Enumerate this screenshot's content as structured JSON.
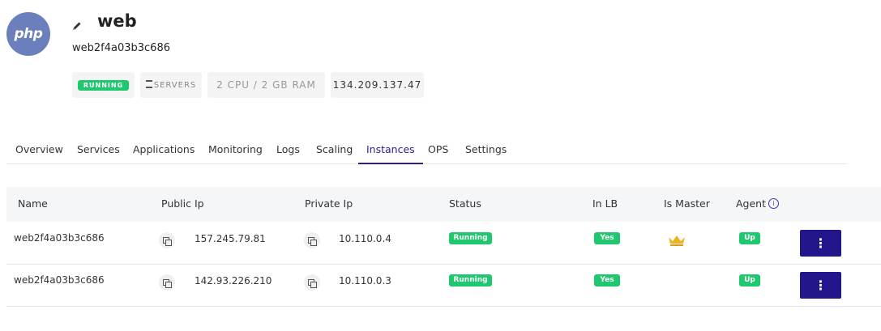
{
  "app": {
    "logo_text": "php",
    "title": "web",
    "subtitle": "web2f4a03b3c686"
  },
  "chips": {
    "status": "RUNNING",
    "type": "SERVERS",
    "spec": "2 CPU / 2 GB RAM",
    "ip": "134.209.137.47"
  },
  "tabs": [
    "Overview",
    "Services",
    "Applications",
    "Monitoring",
    "Logs",
    "Scaling",
    "Instances",
    "OPS",
    "Settings"
  ],
  "active_tab": "Instances",
  "table": {
    "headers": {
      "name": "Name",
      "public_ip": "Public Ip",
      "private_ip": "Private Ip",
      "status": "Status",
      "in_lb": "In LB",
      "is_master": "Is Master",
      "agent": "Agent"
    },
    "info_icon": "i",
    "rows": [
      {
        "name": "web2f4a03b3c686",
        "public_ip": "157.245.79.81",
        "private_ip": "10.110.0.4",
        "status": "Running",
        "in_lb": "Yes",
        "is_master": true,
        "agent": "Up",
        "menu": "⋮"
      },
      {
        "name": "web2f4a03b3c686",
        "public_ip": "142.93.226.210",
        "private_ip": "10.110.0.3",
        "status": "Running",
        "in_lb": "Yes",
        "is_master": false,
        "agent": "Up",
        "menu": "⋮"
      }
    ]
  },
  "colors": {
    "accent": "#23158c",
    "success": "#1fc76f",
    "logo_bg": "#6a7fbc",
    "crown": "#f2b21d"
  },
  "icons": {
    "edit": "pencil-icon",
    "copy": "copy-icon",
    "master": "crown-icon",
    "menu": "kebab-menu-icon",
    "info": "info-icon",
    "servers": "servers-icon"
  }
}
